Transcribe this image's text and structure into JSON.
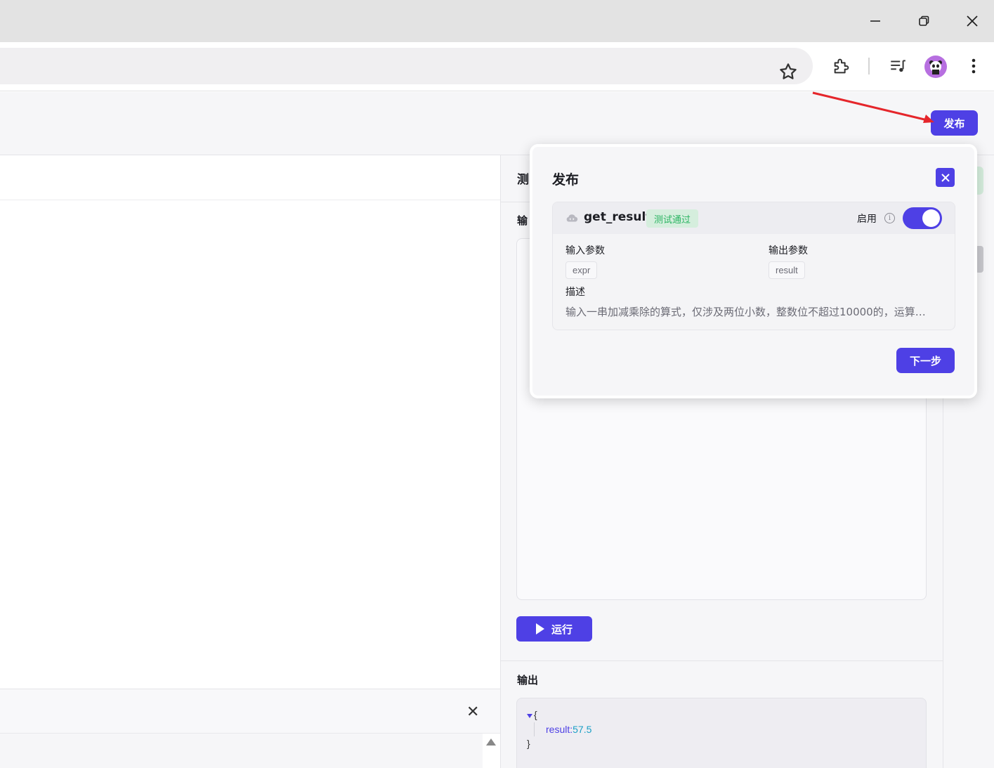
{
  "browser": {
    "window_controls": {
      "minimize": "—",
      "maximize": "❐",
      "close": "✕"
    },
    "icons": [
      "bookmark-star-icon",
      "extensions-icon",
      "media-control-icon",
      "profile-avatar",
      "more-menu-icon"
    ]
  },
  "header": {
    "publish_label": "发布"
  },
  "test_panel": {
    "title": "测",
    "input_label": "输",
    "run_label": "运行",
    "output_label": "输出",
    "output_json": {
      "open": "{",
      "key": "result:",
      "value": "57.5",
      "close": "}"
    }
  },
  "bottom_panel": {
    "close": "✕"
  },
  "publish_dialog": {
    "title": "发布",
    "function_name": "get_result",
    "status_badge": "测试通过",
    "enable_label": "启用",
    "enabled": true,
    "input_params_label": "输入参数",
    "input_params": [
      "expr"
    ],
    "output_params_label": "输出参数",
    "output_params": [
      "result"
    ],
    "description_label": "描述",
    "description": "输入一串加减乘除的算式，仅涉及两位小数，整数位不超过10000的，运算…",
    "next_label": "下一步"
  },
  "colors": {
    "accent": "#4e40e5",
    "success_bg": "#d5eedd",
    "success_text": "#2bb462",
    "annotation_arrow": "#e5262b"
  }
}
